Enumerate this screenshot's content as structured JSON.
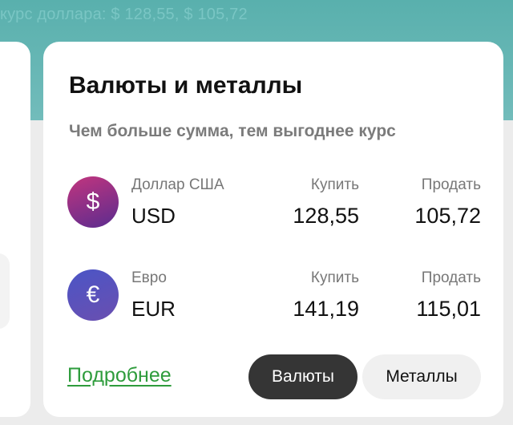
{
  "ticker": {
    "text": "курс доллара: $ 128,55, $ 105,72"
  },
  "colors": {
    "top_band": "#59b0ad",
    "link": "#2e9c3c",
    "active_button": "#353535",
    "usd_badge_gradient": [
      "#c2357e",
      "#5b2c8f"
    ],
    "eur_badge_gradient": [
      "#4b55c6",
      "#6a4fb0"
    ]
  },
  "card": {
    "title": "Валюты и металлы",
    "subtitle": "Чем больше сумма, тем выгоднее курс",
    "rows": [
      {
        "icon": "dollar-icon",
        "symbol": "$",
        "name": "Доллар США",
        "code": "USD",
        "buy_label": "Купить",
        "buy": "128,55",
        "sell_label": "Продать",
        "sell": "105,72"
      },
      {
        "icon": "euro-icon",
        "symbol": "€",
        "name": "Евро",
        "code": "EUR",
        "buy_label": "Купить",
        "buy": "141,19",
        "sell_label": "Продать",
        "sell": "115,01"
      }
    ],
    "more_link": "Подробнее",
    "tabs": {
      "currencies": "Валюты",
      "metals": "Металлы",
      "active": "currencies"
    }
  }
}
